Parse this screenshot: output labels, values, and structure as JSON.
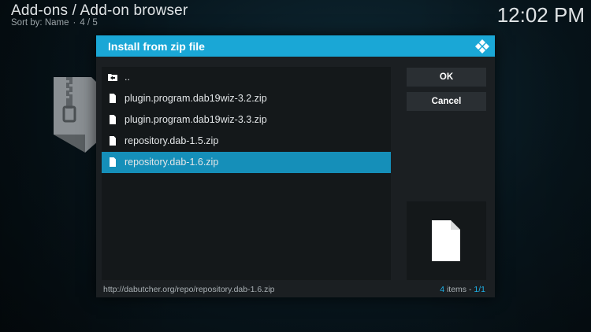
{
  "background": {
    "title": "Add-ons / Add-on browser",
    "sort_label": "Sort by: Name",
    "page_position": "4 / 5",
    "clock": "12:02 PM",
    "art_icon": "zip-file-icon"
  },
  "dialog": {
    "title": "Install from zip file",
    "logo_icon": "kodi-logo-icon",
    "items": [
      {
        "label": "..",
        "icon": "folder-back-icon",
        "selected": false
      },
      {
        "label": "plugin.program.dab19wiz-3.2.zip",
        "icon": "file-icon",
        "selected": false
      },
      {
        "label": "plugin.program.dab19wiz-3.3.zip",
        "icon": "file-icon",
        "selected": false
      },
      {
        "label": "repository.dab-1.5.zip",
        "icon": "file-icon",
        "selected": false
      },
      {
        "label": "repository.dab-1.6.zip",
        "icon": "file-icon",
        "selected": true
      }
    ],
    "ok_label": "OK",
    "cancel_label": "Cancel",
    "preview_icon": "file-icon",
    "footer_path": "http://dabutcher.org/repo/repository.dab-1.6.zip",
    "footer_items_count": "4",
    "footer_items_text": "items -",
    "footer_page": "1/1"
  },
  "colors": {
    "accent": "#1aa7d6",
    "selected_row": "#158fb9",
    "dialog_bg": "#1b1f22",
    "button_bg": "#2a2f33"
  }
}
